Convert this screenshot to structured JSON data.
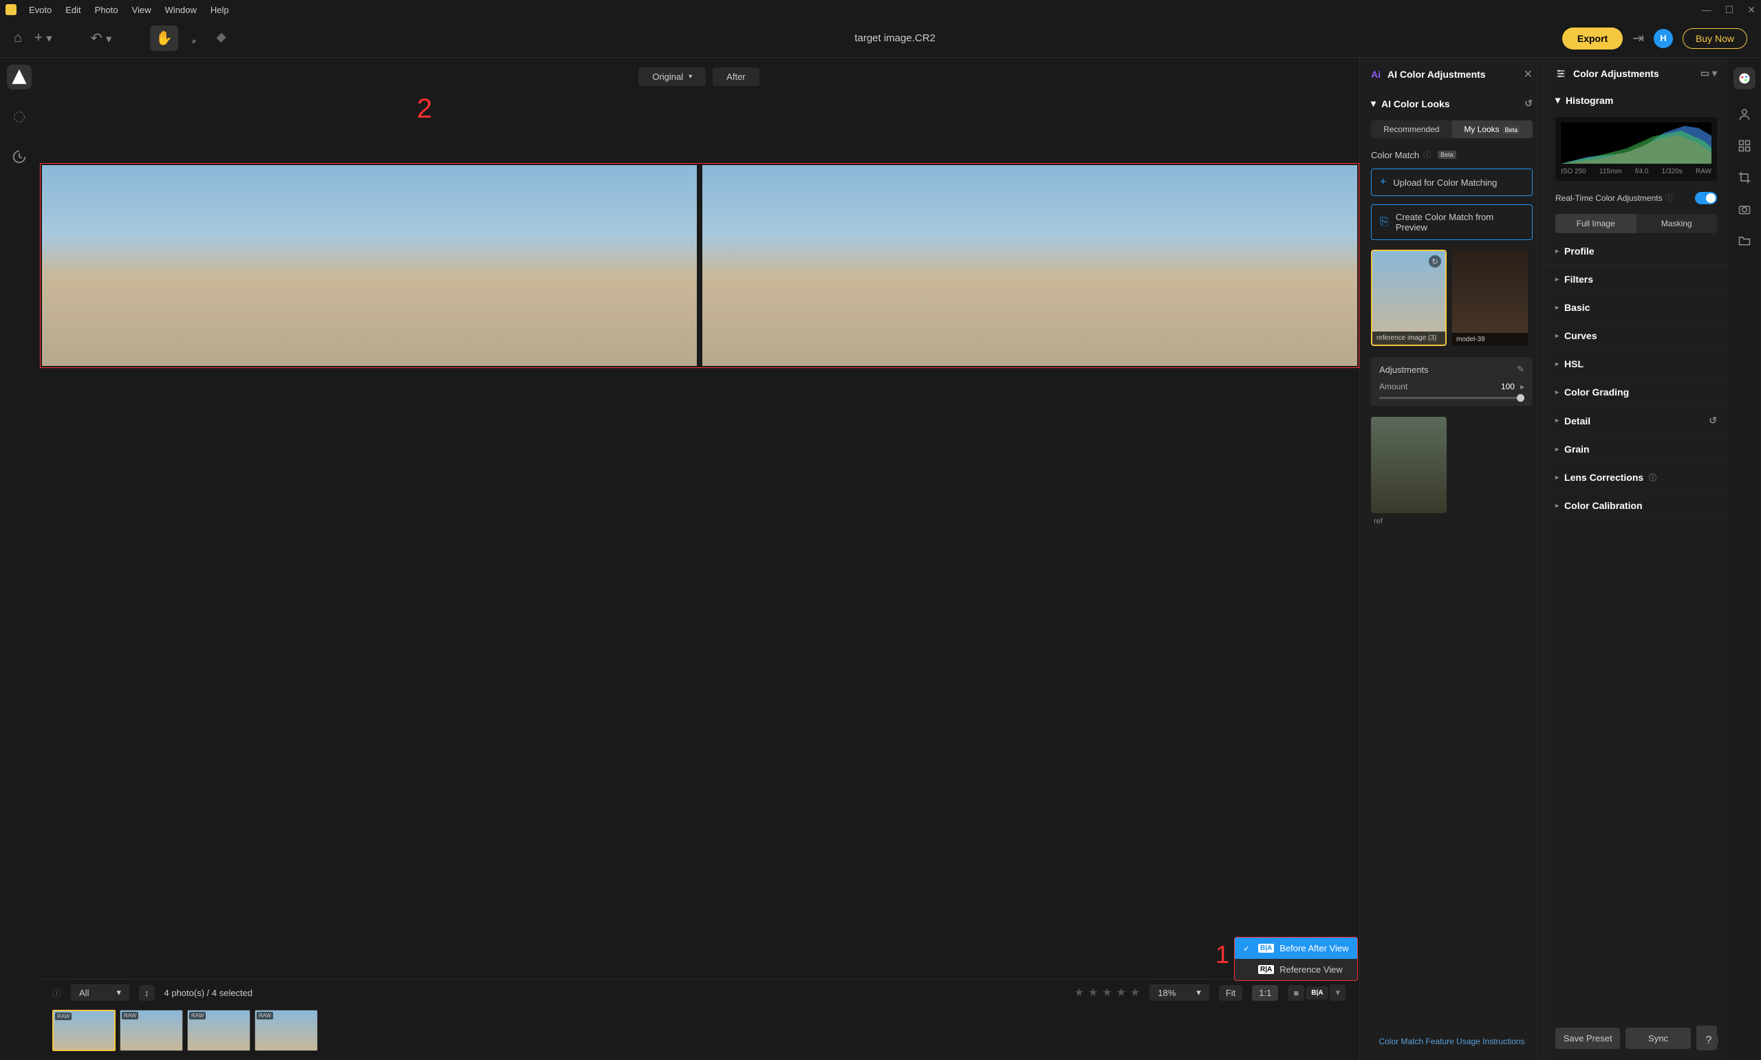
{
  "menubar": {
    "app": "Evoto",
    "items": [
      "Edit",
      "Photo",
      "View",
      "Window",
      "Help"
    ]
  },
  "toolbar": {
    "filename": "target image.CR2",
    "export": "Export",
    "avatar_initial": "H",
    "buy": "Buy Now"
  },
  "view_tabs": {
    "original": "Original",
    "after": "After"
  },
  "annotations": {
    "one": "1",
    "two": "2"
  },
  "bottom": {
    "filter": "All",
    "count": "4 photo(s) / 4 selected",
    "zoom": "18%",
    "fit": "Fit",
    "oneone": "1:1",
    "thumbs": [
      {
        "badge": "RAW",
        "selected": true
      },
      {
        "badge": "RAW",
        "selected": false
      },
      {
        "badge": "RAW",
        "selected": false
      },
      {
        "badge": "RAW",
        "selected": false
      }
    ]
  },
  "view_popup": {
    "before_after": "Before After View",
    "reference": "Reference View"
  },
  "mid_panel": {
    "title": "AI Color Adjustments",
    "ai_looks": "AI Color Looks",
    "recommended": "Recommended",
    "my_looks": "My Looks",
    "beta": "Beta",
    "color_match": "Color Match",
    "upload": "Upload for Color Matching",
    "create_preview": "Create Color Match from Preview",
    "look1": "reference image (3)",
    "look2": "model-39",
    "adjustments": "Adjustments",
    "amount_label": "Amount",
    "amount_value": "100",
    "ref_label": "ref",
    "instructions": "Color Match Feature Usage Instructions"
  },
  "right_panel": {
    "title": "Color Adjustments",
    "histogram": "Histogram",
    "histo_meta": {
      "iso": "ISO 250",
      "focal": "115mm",
      "aperture": "f/4.0",
      "shutter": "1/320s",
      "format": "RAW"
    },
    "realtime": "Real-Time Color Adjustments",
    "full_image": "Full Image",
    "masking": "Masking",
    "sections": [
      "Profile",
      "Filters",
      "Basic",
      "Curves",
      "HSL",
      "Color Grading",
      "Detail",
      "Grain",
      "Lens Corrections",
      "Color Calibration"
    ],
    "save_preset": "Save Preset",
    "sync": "Sync"
  }
}
